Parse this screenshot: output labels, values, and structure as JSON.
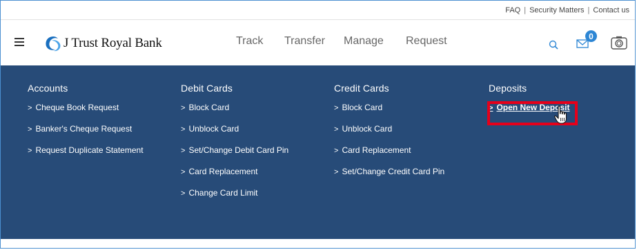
{
  "utility_links": [
    "FAQ",
    "Security Matters",
    "Contact us"
  ],
  "utility_separator": "|",
  "brand": {
    "name": "J Trust Royal Bank"
  },
  "nav": {
    "items": [
      "Track",
      "Transfer",
      "Manage",
      "Request"
    ]
  },
  "notifications": {
    "count": "0"
  },
  "menu": {
    "columns": [
      {
        "title": "Accounts",
        "items": [
          "Cheque Book Request",
          "Banker's Cheque Request",
          "Request Duplicate Statement"
        ]
      },
      {
        "title": "Debit Cards",
        "items": [
          "Block Card",
          "Unblock Card",
          "Set/Change Debit Card Pin",
          "Card Replacement",
          "Change Card Limit"
        ]
      },
      {
        "title": "Credit Cards",
        "items": [
          "Block Card",
          "Unblock Card",
          "Card Replacement",
          "Set/Change Credit Card Pin"
        ]
      },
      {
        "title": "Deposits",
        "items": [
          "Open New Deposit"
        ]
      }
    ],
    "chevron": ">"
  },
  "colors": {
    "menu_bg": "#274b78",
    "accent": "#2d86d4",
    "highlight_box": "#e6001a"
  }
}
